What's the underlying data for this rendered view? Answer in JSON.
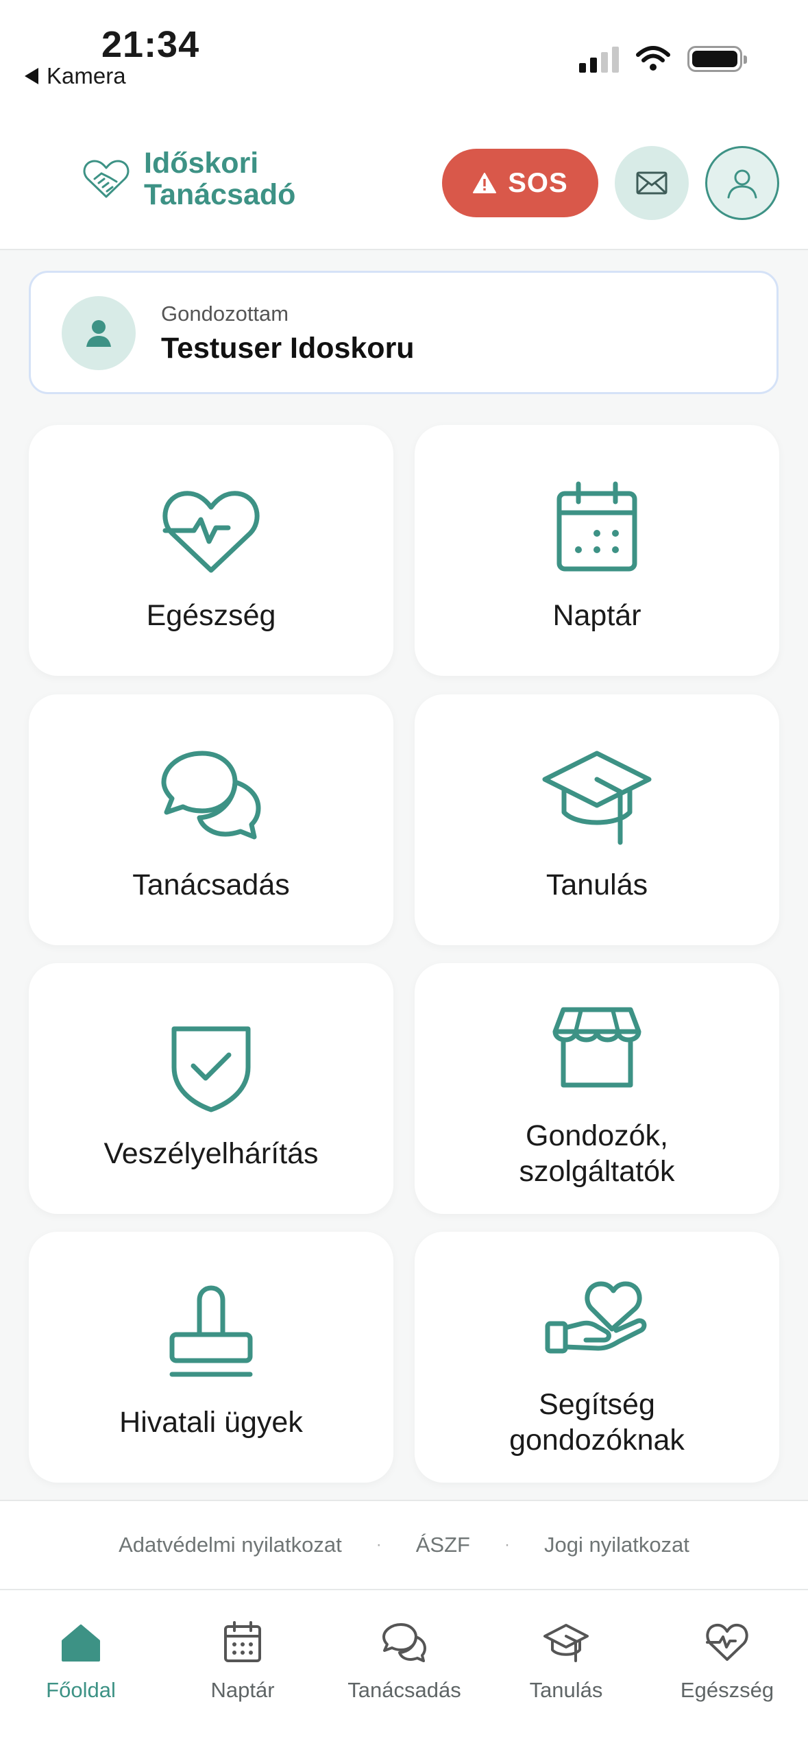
{
  "status_bar": {
    "time": "21:34",
    "back_label": "Kamera"
  },
  "header": {
    "logo_line1": "Időskori",
    "logo_line2": "Tanácsadó",
    "sos_label": "SOS"
  },
  "patient": {
    "label": "Gondozottam",
    "name": "Testuser Idoskoru"
  },
  "tiles": [
    {
      "label": "Egészség",
      "icon": "heart-pulse-icon"
    },
    {
      "label": "Naptár",
      "icon": "calendar-icon"
    },
    {
      "label": "Tanácsadás",
      "icon": "chat-bubbles-icon"
    },
    {
      "label": "Tanulás",
      "icon": "graduation-cap-icon"
    },
    {
      "label": "Veszélyelhárítás",
      "icon": "shield-check-icon"
    },
    {
      "label_line1": "Gondozók,",
      "label_line2": "szolgáltatók",
      "icon": "store-icon"
    },
    {
      "label": "Hivatali ügyek",
      "icon": "stamp-icon"
    },
    {
      "label_line1": "Segítség",
      "label_line2": "gondozóknak",
      "icon": "hand-heart-icon"
    }
  ],
  "footer_links": [
    "Adatvédelmi nyilatkozat",
    "ÁSZF",
    "Jogi nyilatkozat"
  ],
  "tabbar": [
    {
      "label": "Főoldal",
      "icon": "home-icon",
      "active": true
    },
    {
      "label": "Naptár",
      "icon": "calendar-icon"
    },
    {
      "label": "Tanácsadás",
      "icon": "chat-bubbles-icon"
    },
    {
      "label": "Tanulás",
      "icon": "graduation-cap-icon"
    },
    {
      "label": "Egészség",
      "icon": "heart-pulse-icon"
    }
  ],
  "colors": {
    "accent": "#3d9285",
    "sos": "#d9584a",
    "accent_soft": "#d8ebe7",
    "background": "#f6f7f7"
  }
}
